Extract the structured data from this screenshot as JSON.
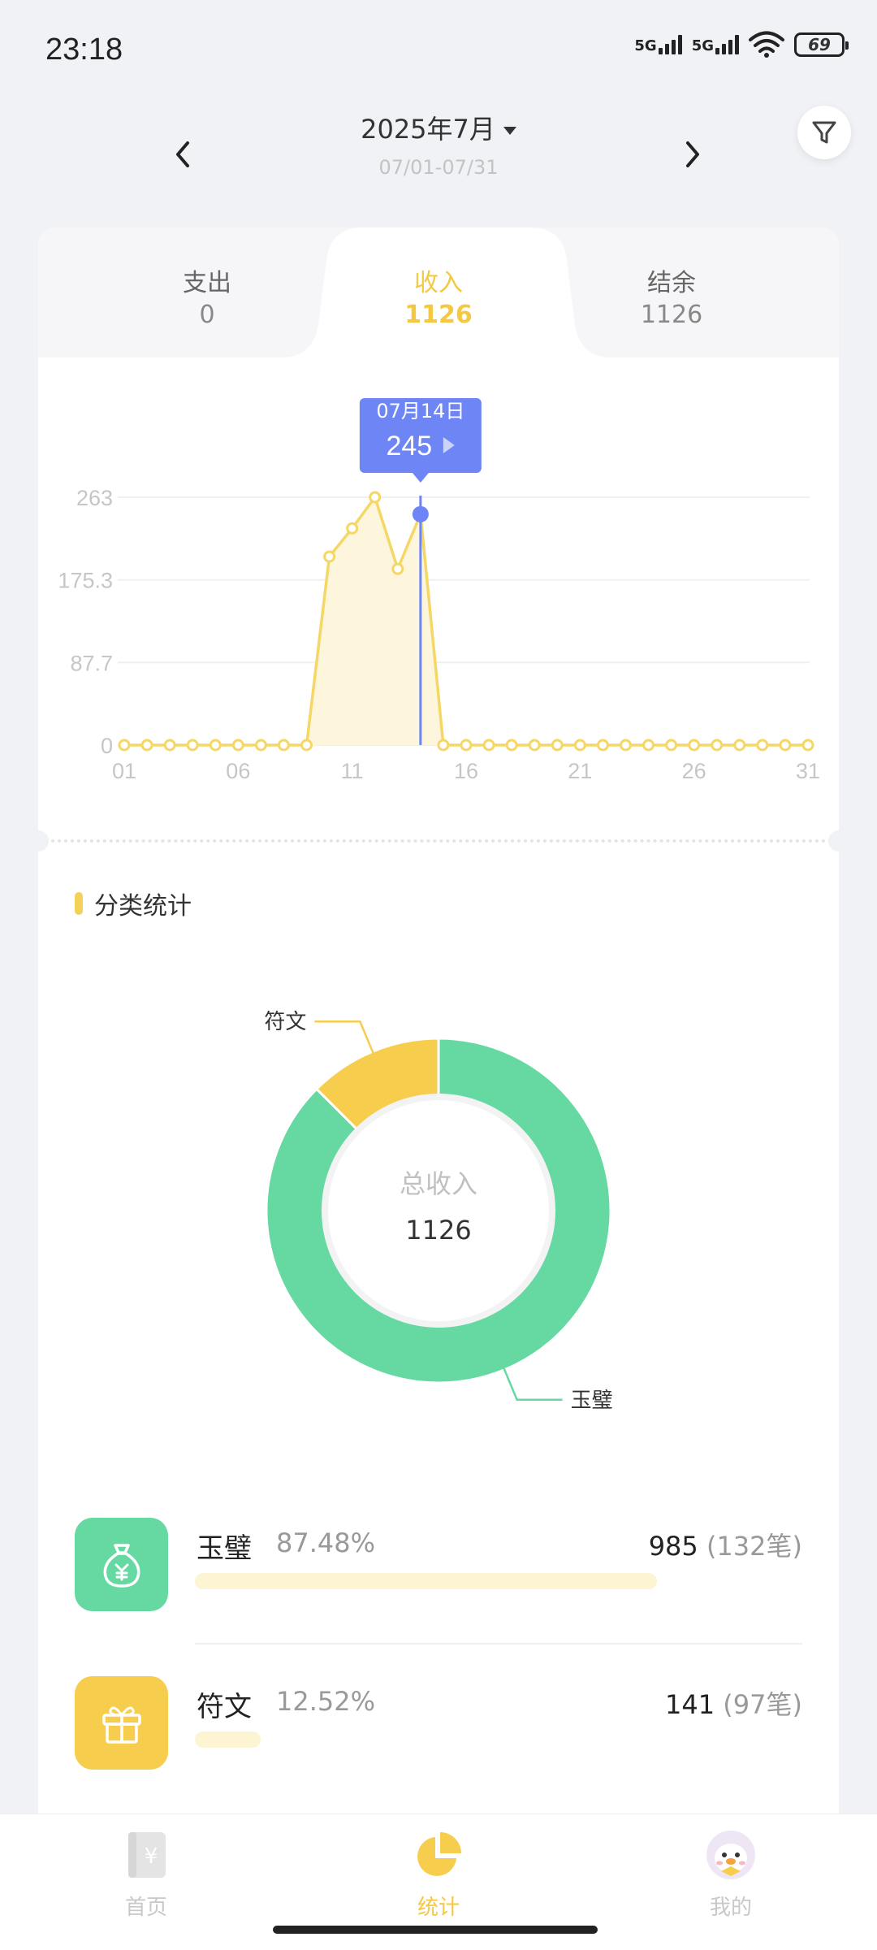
{
  "status_bar": {
    "time": "23:18",
    "signal1": "5G",
    "signal2": "5G",
    "battery": "69"
  },
  "header": {
    "month": "2025年7月",
    "range": "07/01-07/31"
  },
  "tabs": [
    {
      "label": "支出",
      "value": "0"
    },
    {
      "label": "收入",
      "value": "1126"
    },
    {
      "label": "结余",
      "value": "1126"
    }
  ],
  "chart_data": {
    "type": "line",
    "x": [
      "01",
      "02",
      "03",
      "04",
      "05",
      "06",
      "07",
      "08",
      "09",
      "10",
      "11",
      "12",
      "13",
      "14",
      "15",
      "16",
      "17",
      "18",
      "19",
      "20",
      "21",
      "22",
      "23",
      "24",
      "25",
      "26",
      "27",
      "28",
      "29",
      "30",
      "31"
    ],
    "values": [
      0,
      0,
      0,
      0,
      0,
      0,
      0,
      0,
      0,
      200,
      230,
      263,
      187,
      245,
      0,
      0,
      0,
      0,
      0,
      0,
      0,
      0,
      0,
      0,
      0,
      0,
      0,
      0,
      0,
      0,
      0
    ],
    "x_tick_labels": [
      "01",
      "06",
      "11",
      "16",
      "21",
      "26",
      "31"
    ],
    "y_tick_labels": [
      "0",
      "87.7",
      "175.3",
      "263"
    ],
    "ylim": [
      0,
      263
    ],
    "grid": true,
    "tooltip": {
      "date": "07月14日",
      "value": "245"
    },
    "colors": {
      "line": "#f5d766",
      "fill": "#fdf6dc",
      "marker": "#6e86f5"
    }
  },
  "category": {
    "title": "分类统计",
    "donut": {
      "center_label": "总收入",
      "center_value": "1126",
      "slices": [
        {
          "name": "玉璧",
          "value": 985,
          "color": "#66d9a3"
        },
        {
          "name": "符文",
          "value": 141,
          "color": "#f7cd4d"
        }
      ]
    },
    "items": [
      {
        "name": "玉璧",
        "percent": "87.48%",
        "amount": "985",
        "count": "(132笔)",
        "fraction": 0.8748,
        "color": "#66d9a3",
        "icon": "money-bag-icon"
      },
      {
        "name": "符文",
        "percent": "12.52%",
        "amount": "141",
        "count": "(97笔)",
        "fraction": 0.1252,
        "color": "#f7cd4d",
        "icon": "gift-icon"
      }
    ]
  },
  "nav": [
    {
      "label": "首页",
      "icon": "ledger-icon"
    },
    {
      "label": "统计",
      "icon": "pie-chart-icon"
    },
    {
      "label": "我的",
      "icon": "avatar-icon"
    }
  ]
}
